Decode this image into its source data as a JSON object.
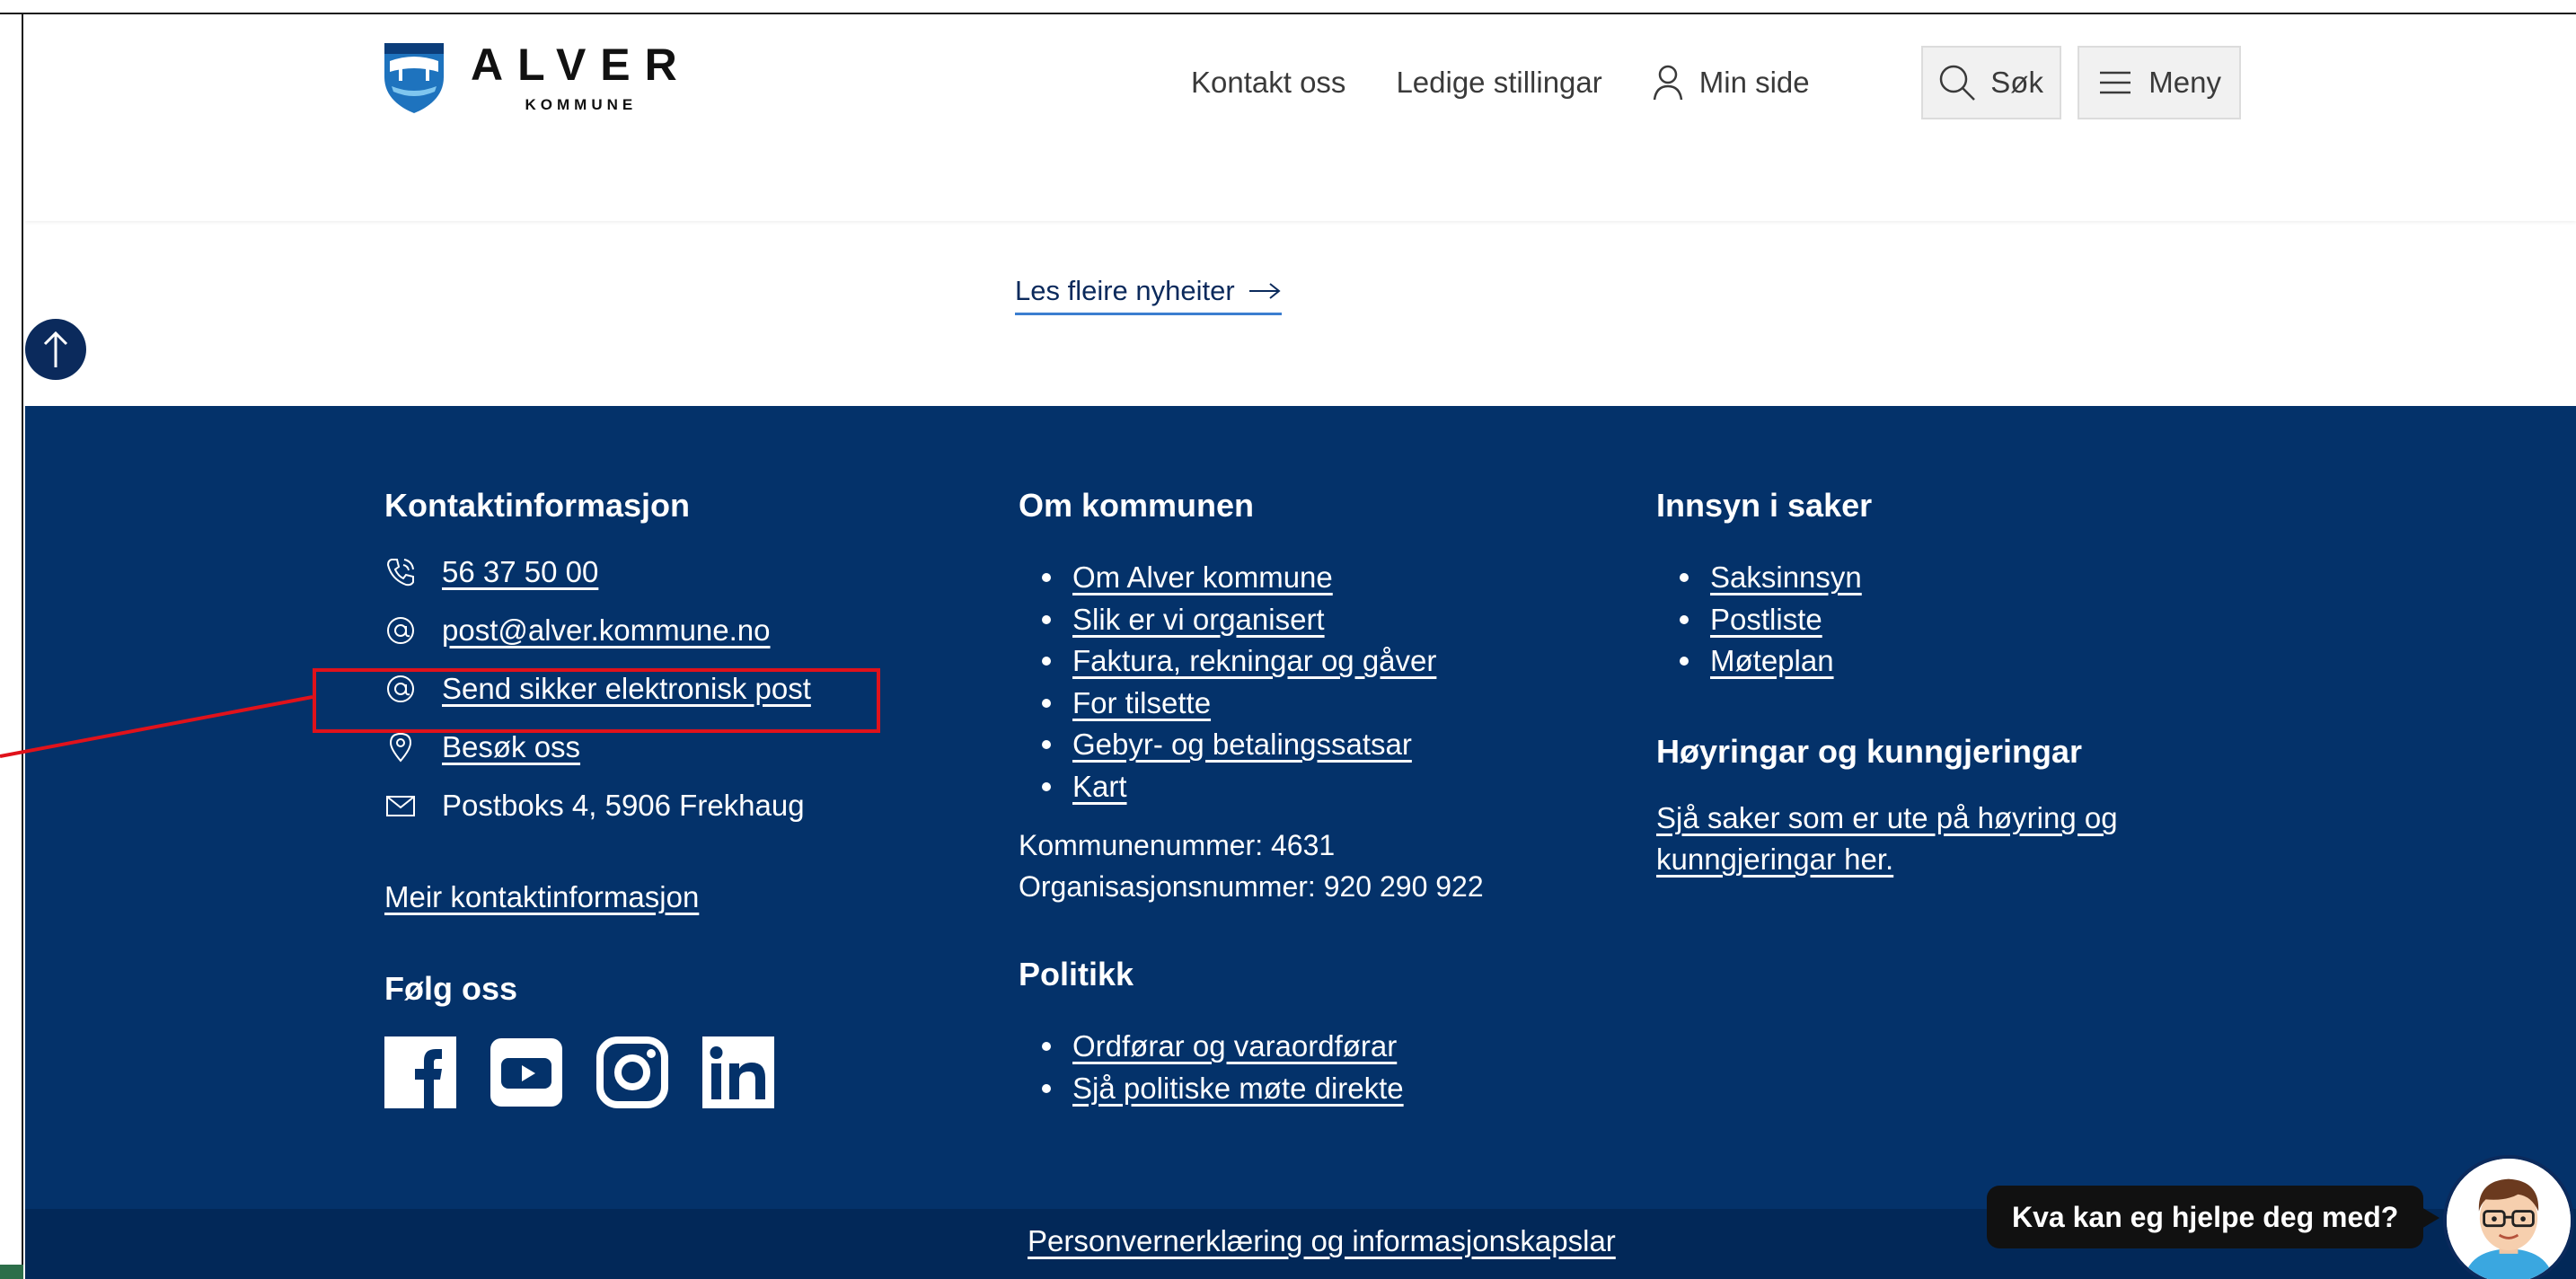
{
  "header": {
    "logo_main": "ALVER",
    "logo_sub": "KOMMUNE",
    "nav": {
      "kontakt": "Kontakt oss",
      "stillingar": "Ledige stillingar",
      "min_side": "Min side"
    },
    "search_label": "Søk",
    "menu_label": "Meny"
  },
  "main": {
    "more_news": "Les fleire nyheiter"
  },
  "footer": {
    "contact": {
      "title": "Kontaktinformasjon",
      "phone": "56 37 50 00",
      "email": "post@alver.kommune.no",
      "secure_mail": "Send sikker elektronisk post",
      "visit": "Besøk oss",
      "address": "Postboks 4, 5906 Frekhaug",
      "more": "Meir kontaktinformasjon"
    },
    "follow": {
      "title": "Følg oss",
      "icons": [
        "facebook-icon",
        "youtube-icon",
        "instagram-icon",
        "linkedin-icon"
      ]
    },
    "about": {
      "title": "Om kommunen",
      "links": [
        "Om Alver kommune",
        "Slik er vi organisert",
        "Faktura, rekningar og gåver",
        "For tilsette",
        "Gebyr- og betalingssatsar ",
        "Kart"
      ],
      "kommunenummer": "Kommunenummer: 4631",
      "orgnummer": "Organisasjonsnummer: 920 290 922"
    },
    "politics": {
      "title": "Politikk",
      "links": [
        "Ordførar og varaordførar",
        "Sjå politiske møte direkte"
      ]
    },
    "innsyn": {
      "title": "Innsyn i saker",
      "links": [
        "Saksinnsyn",
        "Postliste",
        "Møteplan"
      ]
    },
    "hoyring": {
      "title": "Høyringar og kunngjeringar",
      "line1": "Sjå saker som er ute på høyring og",
      "line2": "kunngjeringar her."
    },
    "privacy": "Personvernerklæring og informasjonskapslar"
  },
  "chat": {
    "prompt": "Kva kan eg hjelpe deg med?"
  },
  "colors": {
    "footer_bg": "#04326a",
    "footer_bottom_bg": "#022858",
    "highlight": "#e0121b",
    "link_underline": "#3b7ed0"
  }
}
